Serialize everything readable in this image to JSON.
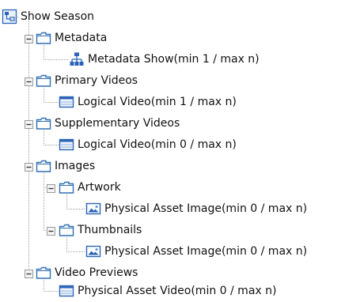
{
  "tree": {
    "nodes": [
      {
        "label": "Show Season",
        "icon": "hierarchy-root-icon",
        "expanded": true
      },
      {
        "label": "Metadata",
        "icon": "folder-icon",
        "expanded": true
      },
      {
        "label": "Metadata Show(min 1 / max n)",
        "icon": "metadata-structure-icon"
      },
      {
        "label": "Primary Videos",
        "icon": "folder-icon",
        "expanded": true
      },
      {
        "label": "Logical Video(min 1 / max n)",
        "icon": "video-window-icon"
      },
      {
        "label": "Supplementary Videos",
        "icon": "folder-icon",
        "expanded": true
      },
      {
        "label": "Logical Video(min 0 / max n)",
        "icon": "video-window-icon"
      },
      {
        "label": "Images",
        "icon": "folder-icon",
        "expanded": true
      },
      {
        "label": "Artwork",
        "icon": "folder-icon",
        "expanded": true
      },
      {
        "label": "Physical Asset Image(min 0 / max n)",
        "icon": "image-icon"
      },
      {
        "label": "Thumbnails",
        "icon": "folder-icon",
        "expanded": true
      },
      {
        "label": "Physical Asset Image(min 0 / max n)",
        "icon": "image-icon"
      },
      {
        "label": "Video Previews",
        "icon": "folder-icon",
        "expanded": true
      },
      {
        "label": "Physical Asset Video(min 0 / max n)",
        "icon": "video-window-icon"
      }
    ]
  },
  "colors": {
    "folder_stroke": "#2f6fb3",
    "folder_fill": "#ffffff",
    "icon_blue": "#2b63b8",
    "line": "#a0a0a0",
    "text": "#111111"
  }
}
